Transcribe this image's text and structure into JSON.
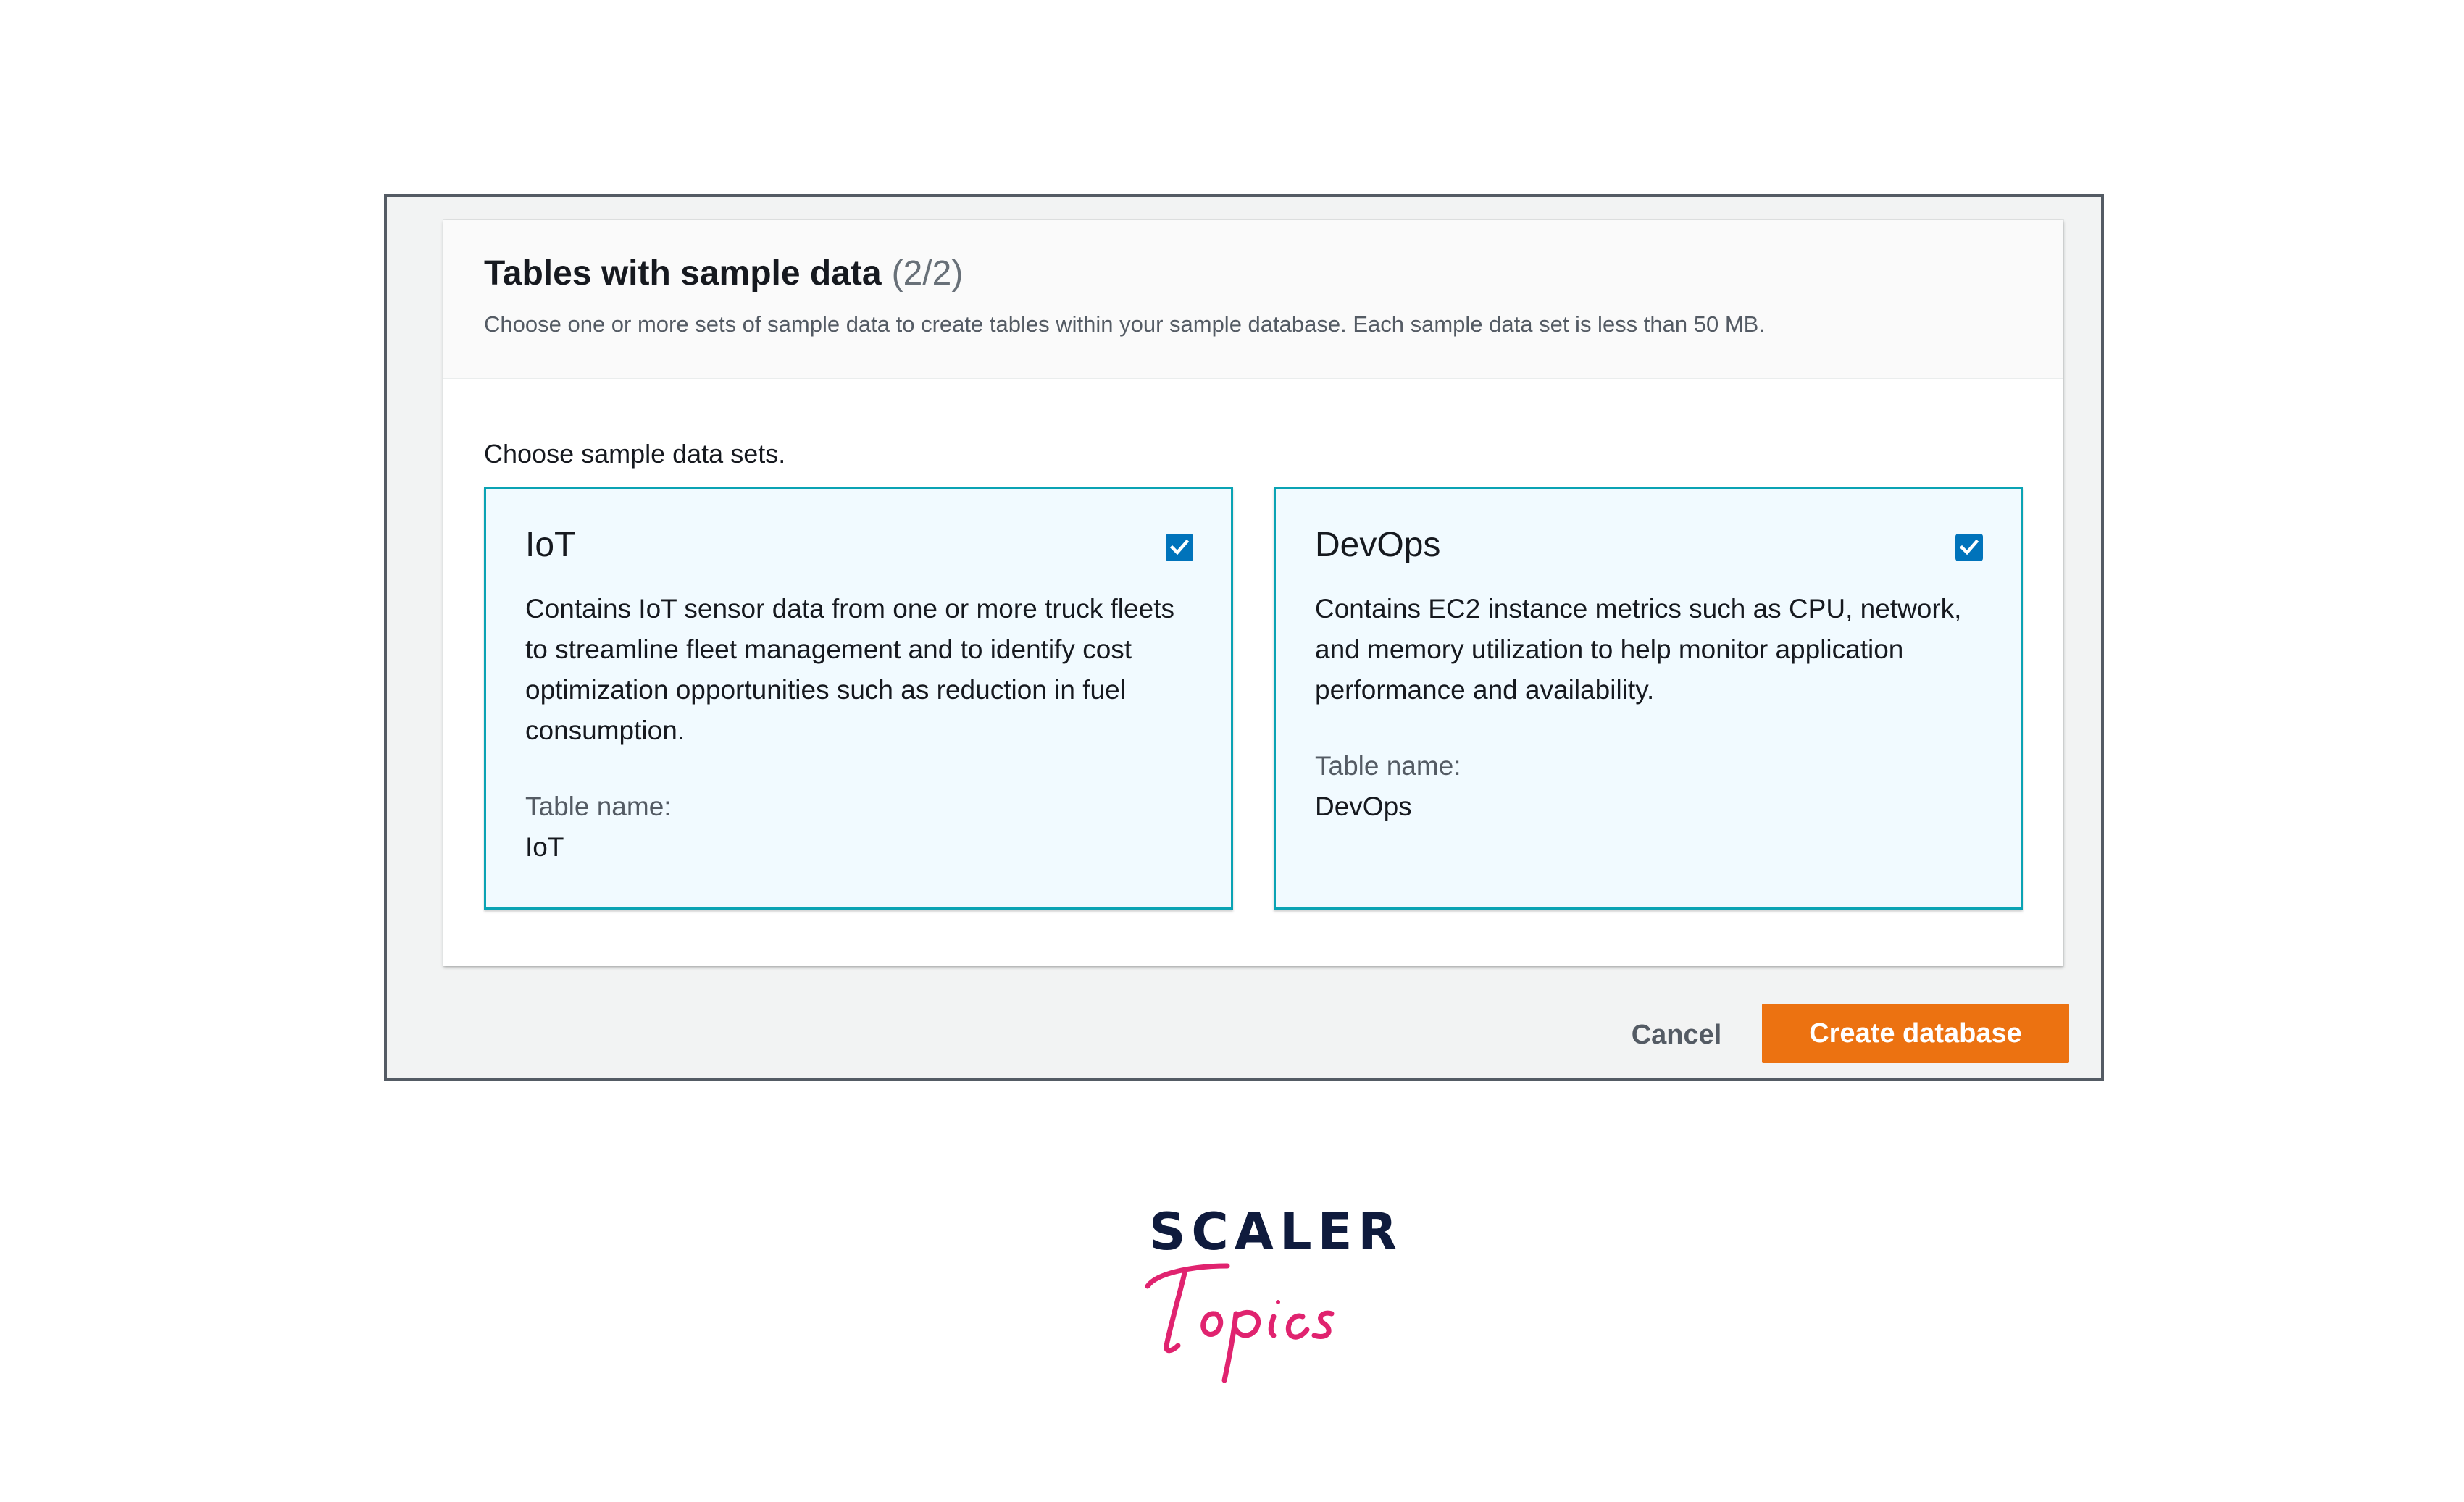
{
  "panel": {
    "title": "Tables with sample data",
    "counter": "(2/2)",
    "description": "Choose one or more sets of sample data to create tables within your sample database. Each sample data set is less than 50 MB.",
    "choose_label": "Choose sample data sets."
  },
  "tiles": [
    {
      "title": "IoT",
      "checked": true,
      "description": "Contains IoT sensor data from one or more truck fleets to streamline fleet management and to identify cost optimization opportunities such as reduction in fuel consumption.",
      "table_label": "Table name:",
      "table_value": "IoT"
    },
    {
      "title": "DevOps",
      "checked": true,
      "description": "Contains EC2 instance metrics such as CPU, network, and memory utilization to help monitor application performance and availability.",
      "table_label": "Table name:",
      "table_value": "DevOps"
    }
  ],
  "actions": {
    "cancel_label": "Cancel",
    "create_label": "Create database"
  },
  "logo": {
    "word": "SCALER",
    "script": "Topics"
  },
  "colors": {
    "accent_orange": "#ec7211",
    "tile_border": "#0aa3b4",
    "tile_background": "#f1faff",
    "checkbox_blue": "#0073bb",
    "logo_navy": "#0f1b3d",
    "logo_pink": "#e0236f"
  },
  "icons": {
    "checkbox": "checkmark-icon"
  }
}
